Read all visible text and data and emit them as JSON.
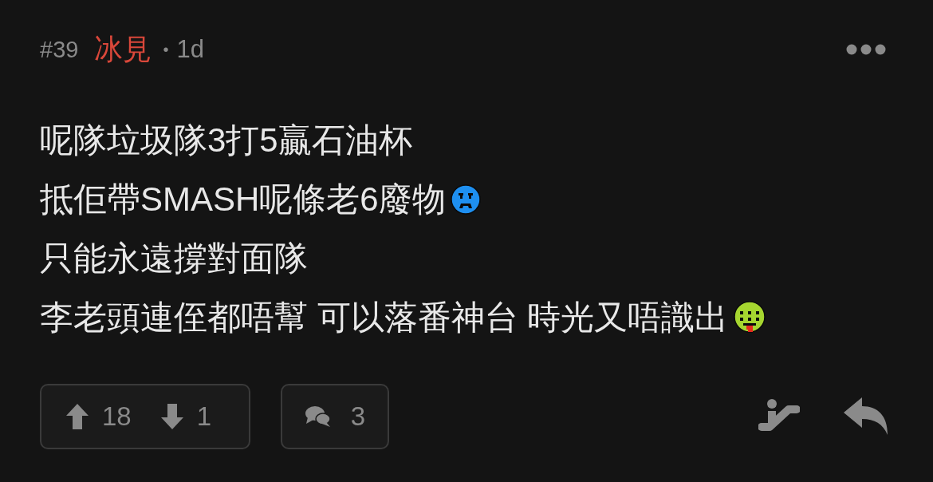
{
  "post": {
    "number": "#39",
    "author": "冰見",
    "separator": "•",
    "age": "1d"
  },
  "lines": [
    {
      "text": "呢隊垃圾隊3打5贏石油杯",
      "kind": "plain"
    },
    {
      "text": "抵佢帶SMASH呢條老6廢物",
      "kind": "sad"
    },
    {
      "text": "只能永遠撐對面隊",
      "kind": "plain"
    },
    {
      "text": "李老頭連侄都唔幫 可以落番神台 時光又唔識出",
      "kind": "sick"
    }
  ],
  "votes": {
    "up": "18",
    "down": "1"
  },
  "comments": "3"
}
